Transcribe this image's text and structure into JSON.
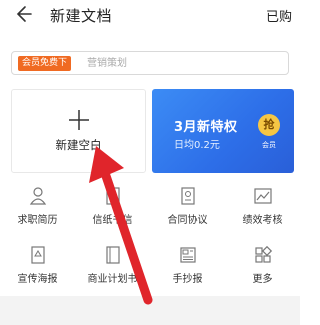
{
  "header": {
    "title": "新建文档",
    "purchased": "已购"
  },
  "search": {
    "promo": "会员免费下",
    "placeholder": "营销策划"
  },
  "blank_card": {
    "label": "新建空白"
  },
  "banner": {
    "title": "3月新特权",
    "subtitle": "日均0.2元",
    "badge": "抢",
    "badge_label": "会员"
  },
  "templates": [
    {
      "label": "求职简历",
      "icon": "person-icon"
    },
    {
      "label": "信纸书信",
      "icon": "letter-icon"
    },
    {
      "label": "合同协议",
      "icon": "contract-icon"
    },
    {
      "label": "绩效考核",
      "icon": "chart-icon"
    },
    {
      "label": "宣传海报",
      "icon": "poster-icon"
    },
    {
      "label": "商业计划书",
      "icon": "book-icon"
    },
    {
      "label": "手抄报",
      "icon": "newspaper-icon"
    },
    {
      "label": "更多",
      "icon": "grid-icon"
    }
  ],
  "colors": {
    "accent": "#f06a22",
    "banner": "#3c8cf5",
    "arrow": "#e0252b"
  }
}
